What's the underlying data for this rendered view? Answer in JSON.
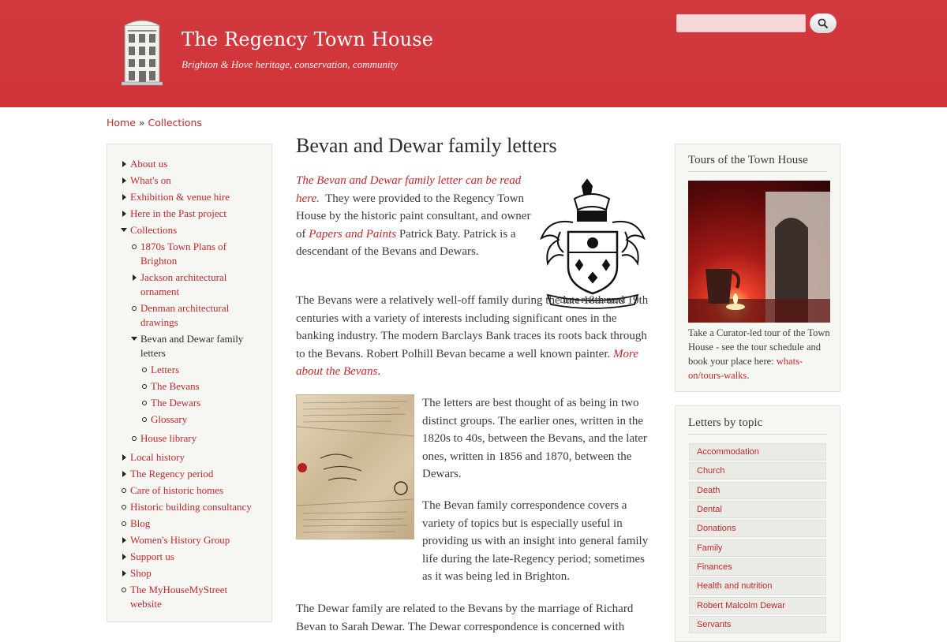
{
  "header": {
    "site_name": "The Regency Town House",
    "slogan": "Brighton & Hove heritage, conservation, community",
    "search_placeholder": ""
  },
  "breadcrumb": {
    "home": "Home",
    "sep": "»",
    "current": "Collections"
  },
  "sidebar": {
    "items": [
      {
        "label": "About us",
        "marker": "tri-right"
      },
      {
        "label": "What's on",
        "marker": "tri-right"
      },
      {
        "label": "Exhibition & venue hire",
        "marker": "tri-right"
      },
      {
        "label": "Here in the Past project",
        "marker": "tri-right"
      },
      {
        "label": "Collections",
        "marker": "tri-down"
      },
      {
        "label": "1870s Town Plans of Brighton",
        "marker": "circle"
      },
      {
        "label": "Jackson architectural ornament",
        "marker": "tri-right"
      },
      {
        "label": "Denman architectural drawings",
        "marker": "circle"
      },
      {
        "label": "Bevan and Dewar family letters",
        "marker": "tri-down"
      },
      {
        "label": "Letters",
        "marker": "circle"
      },
      {
        "label": "The Bevans",
        "marker": "circle"
      },
      {
        "label": "The Dewars",
        "marker": "circle"
      },
      {
        "label": "Glossary",
        "marker": "circle"
      },
      {
        "label": "House library",
        "marker": "circle"
      },
      {
        "label": "Local history",
        "marker": "tri-right"
      },
      {
        "label": "The Regency period",
        "marker": "tri-right"
      },
      {
        "label": "Care of historic homes",
        "marker": "circle"
      },
      {
        "label": "Historic building consultancy",
        "marker": "circle"
      },
      {
        "label": "Blog",
        "marker": "circle"
      },
      {
        "label": "Women's History Group",
        "marker": "tri-right"
      },
      {
        "label": "Support us",
        "marker": "tri-right"
      },
      {
        "label": "Shop",
        "marker": "tri-right"
      },
      {
        "label": "The MyHouseMyStreet website",
        "marker": "circle"
      }
    ]
  },
  "main": {
    "title": "Bevan and Dewar family letters",
    "p1_link": "The Bevan and Dewar family letter can be read here.",
    "p1_text_a": "They were provided to the Regency Town House  by the historic paint consultant, and owner of",
    "p1_link2": "Papers and Paints",
    "p1_text_b": "Patrick Baty. Patrick is a descendant of the Bevans and Dewars.",
    "p2_text": "The Bevans were a relatively well-off family during the late 18th and 19th centuries with a variety of interests including significant ones in the banking industry. The modern Barclays Bank traces its roots back through to the Bevans. Robert Polhill Bevan became a well known painter.",
    "p2_link": "More about the Bevans",
    "p2_end": ".",
    "p3_text": "The letters are best thought of as being in two distinct groups. The earlier ones, written in the 1820s to 40s, between the Bevans,  and the later ones, written in 1856 and 1870, between the Dewars.",
    "p4_text": "The Bevan family correspondence covers a variety of topics but is especially useful in providing us with an insight into general family life during the late-Regency period; sometimes as it was being led in Brighton.",
    "p5_text": "The Dewar family are related to the Bevans by the marriage of Richard Bevan to Sarah Dewar. The Dewar correspondence is concerned with",
    "crest_motto": "DEUS PRAESIDIUM"
  },
  "tours": {
    "title": "Tours of the Town House",
    "text": "Take a Curator-led tour of the Town House - see the tour schedule and book your place here:",
    "link": "whats-on/tours-walks",
    "end": "."
  },
  "topics": {
    "title": "Letters by topic",
    "items": [
      "Accommodation",
      "Church",
      "Death",
      "Dental",
      "Donations",
      "Family",
      "Finances",
      "Health and nutrition",
      "Robert Malcolm Dewar",
      "Servants"
    ]
  },
  "colors": {
    "header_bg": "#d0333a",
    "link": "#c0282d",
    "block_bg": "#f6f6f2"
  }
}
